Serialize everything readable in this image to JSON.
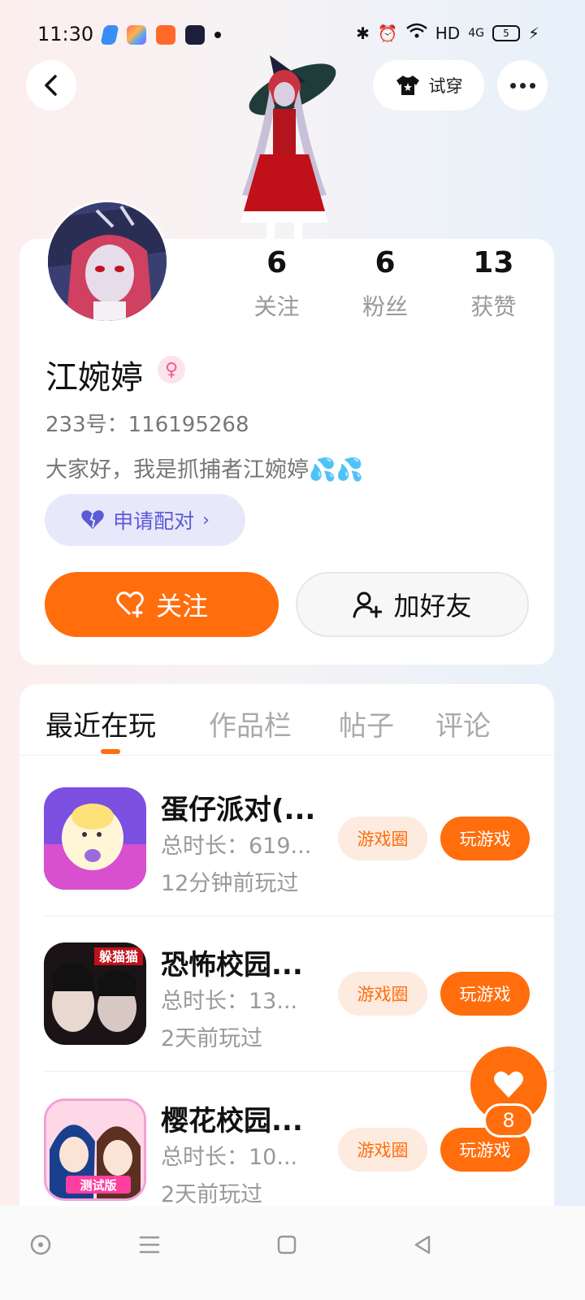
{
  "status_bar": {
    "time": "11:30",
    "network": "HD",
    "signal": "4G",
    "battery": "5"
  },
  "header": {
    "tryon_label": "试穿",
    "back_icon": "back-icon",
    "more_icon": "more-icon"
  },
  "profile": {
    "name": "江婉婷",
    "gender": "female",
    "id_text": "233号：116195268",
    "bio": "大家好，我是抓捕者江婉婷",
    "bio_emoji": "💦💦",
    "pair_label": "申请配对",
    "follow_label": "关注",
    "add_friend_label": "加好友"
  },
  "stats": [
    {
      "value": "6",
      "label": "关注"
    },
    {
      "value": "6",
      "label": "粉丝"
    },
    {
      "value": "13",
      "label": "获赞"
    }
  ],
  "tabs": [
    {
      "label": "最近在玩",
      "active": true
    },
    {
      "label": "作品栏",
      "active": false
    },
    {
      "label": "帖子",
      "active": false
    },
    {
      "label": "评论",
      "active": false
    }
  ],
  "games": [
    {
      "title": "蛋仔派对(...",
      "time": "总时长：619...",
      "last": "12分钟前玩过",
      "circle_label": "游戏圈",
      "play_label": "玩游戏"
    },
    {
      "title": "恐怖校园...",
      "time": "总时长：13...",
      "last": "2天前玩过",
      "circle_label": "游戏圈",
      "play_label": "玩游戏"
    },
    {
      "title": "樱花校园...",
      "time": "总时长：10...",
      "last": "2天前玩过",
      "circle_label": "游戏圈",
      "play_label": "玩游戏"
    }
  ],
  "game_icon_labels": [
    "躲猫猫",
    "测试版"
  ],
  "float_like": {
    "count": "8"
  },
  "colors": {
    "accent": "#ff6d0d",
    "pair_bg": "#e8e8fb",
    "pair_text": "#5b5bd6"
  }
}
